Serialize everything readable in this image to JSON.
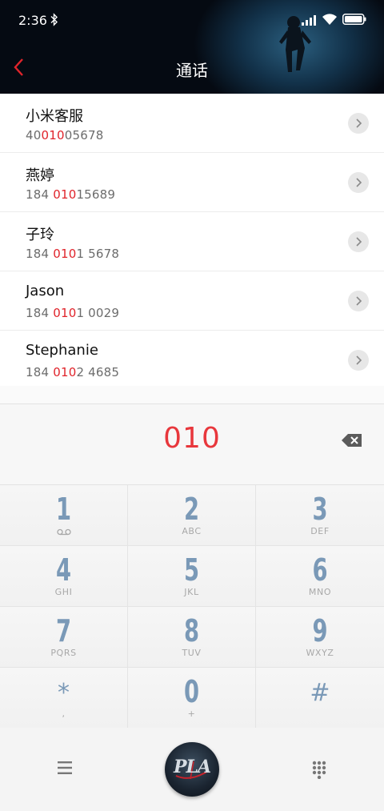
{
  "status_bar": {
    "time": "2:36"
  },
  "header": {
    "title": "通话"
  },
  "contacts": [
    {
      "name": "小米客服",
      "number_pre": "40",
      "number_match": "010",
      "number_post": "05678"
    },
    {
      "name": "燕婷",
      "number_pre": "184 ",
      "number_match": "010",
      "number_post": "15689"
    },
    {
      "name": "子玲",
      "number_pre": "184 ",
      "number_match": "010",
      "number_post": "1 5678"
    },
    {
      "name": "Jason",
      "number_pre": "184 ",
      "number_match": "010",
      "number_post": "1 0029"
    },
    {
      "name": "Stephanie",
      "number_pre": "184 ",
      "number_match": "010",
      "number_post": "2 4685"
    }
  ],
  "dial": {
    "number": "010"
  },
  "keypad": [
    {
      "digit": "1",
      "letters": ""
    },
    {
      "digit": "2",
      "letters": "ABC"
    },
    {
      "digit": "3",
      "letters": "DEF"
    },
    {
      "digit": "4",
      "letters": "GHI"
    },
    {
      "digit": "5",
      "letters": "JKL"
    },
    {
      "digit": "6",
      "letters": "MNO"
    },
    {
      "digit": "7",
      "letters": "PQRS"
    },
    {
      "digit": "8",
      "letters": "TUV"
    },
    {
      "digit": "9",
      "letters": "WXYZ"
    },
    {
      "digit": "*",
      "letters": ","
    },
    {
      "digit": "0",
      "letters": "+"
    },
    {
      "digit": "#",
      "letters": ""
    }
  ],
  "call_logo": {
    "text": "PLA"
  },
  "colors": {
    "accent": "#e8373c",
    "highlight": "#e0242b",
    "key_digit": "#7a99b7"
  },
  "icons": [
    "bluetooth-icon",
    "signal-icon",
    "wifi-icon",
    "battery-icon",
    "back-arrow-icon",
    "chevron-right-icon",
    "backspace-icon",
    "voicemail-icon",
    "menu-icon",
    "dialpad-icon"
  ]
}
